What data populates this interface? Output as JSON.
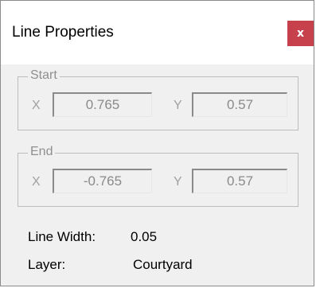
{
  "window": {
    "title": "Line Properties",
    "close_label": "x"
  },
  "start": {
    "legend": "Start",
    "x_label": "X",
    "x_value": "0.765",
    "y_label": "Y",
    "y_value": "0.57"
  },
  "end": {
    "legend": "End",
    "x_label": "X",
    "x_value": "-0.765",
    "y_label": "Y",
    "y_value": "0.57"
  },
  "line_width": {
    "label": "Line Width:",
    "value": "0.05"
  },
  "layer": {
    "label": "Layer:",
    "value": "Courtyard"
  },
  "colors": {
    "close_button": "#c7414c",
    "window_bg": "#f0f0f0",
    "disabled_text": "#8a8a8a"
  }
}
